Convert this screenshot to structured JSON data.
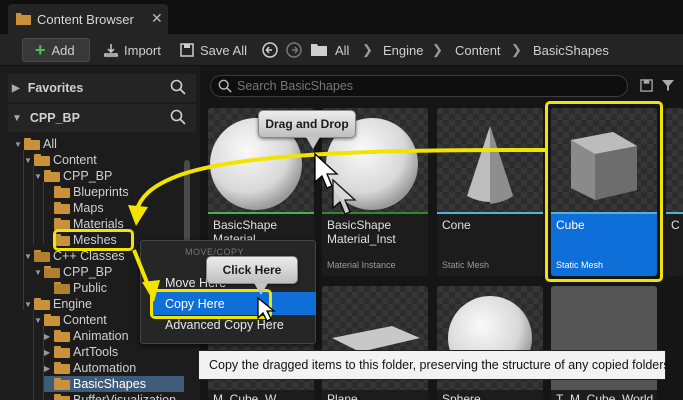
{
  "window": {
    "tab_title": "Content Browser",
    "close_glyph": "✕"
  },
  "toolbar": {
    "add_label": "Add",
    "import_label": "Import",
    "save_all_label": "Save All",
    "breadcrumb": [
      "All",
      "Engine",
      "Content",
      "BasicShapes"
    ]
  },
  "left_panel": {
    "favorites_label": "Favorites",
    "project_label": "CPP_BP",
    "tree": [
      {
        "label": "All",
        "level": 0,
        "open": true
      },
      {
        "label": "Content",
        "level": 1,
        "open": true
      },
      {
        "label": "CPP_BP",
        "level": 2,
        "open": true
      },
      {
        "label": "Blueprints",
        "level": 3
      },
      {
        "label": "Maps",
        "level": 3
      },
      {
        "label": "Materials",
        "level": 3
      },
      {
        "label": "Meshes",
        "level": 3
      },
      {
        "label": "C++ Classes",
        "level": 1,
        "open": true
      },
      {
        "label": "CPP_BP",
        "level": 2,
        "open": true
      },
      {
        "label": "Public",
        "level": 3
      },
      {
        "label": "Engine",
        "level": 1,
        "open": true
      },
      {
        "label": "Content",
        "level": 2,
        "open": true
      },
      {
        "label": "Animation",
        "level": 3
      },
      {
        "label": "ArtTools",
        "level": 3
      },
      {
        "label": "Automation",
        "level": 3
      },
      {
        "label": "BasicShapes",
        "level": 3,
        "selected": true
      },
      {
        "label": "BufferVisualization",
        "level": 3
      }
    ]
  },
  "content": {
    "search_placeholder": "Search BasicShapes",
    "assets": [
      {
        "name": "BasicShape Material",
        "type": ""
      },
      {
        "name": "BasicShape Material_Inst",
        "type": "Material Instance"
      },
      {
        "name": "Cone",
        "type": "Static Mesh"
      },
      {
        "name": "Cube",
        "type": "Static Mesh",
        "selected": true
      }
    ],
    "bottom_row": [
      "M_Cube_W",
      "Plane",
      "Sphere",
      "T_M_Cube_World"
    ]
  },
  "context_menu": {
    "header": "MOVE/COPY",
    "items": [
      "Move Here",
      "Copy Here",
      "Advanced Copy Here"
    ]
  },
  "annotations": {
    "drag_drop": "Drag and Drop",
    "click_here": "Click Here"
  },
  "tooltip": "Copy the dragged items to this folder, preserving the structure of any copied folders.",
  "colors": {
    "accent": "#0e6fd8",
    "highlight": "#f2e300",
    "folder": "#c8913a",
    "add_icon": "#4fc14f"
  }
}
